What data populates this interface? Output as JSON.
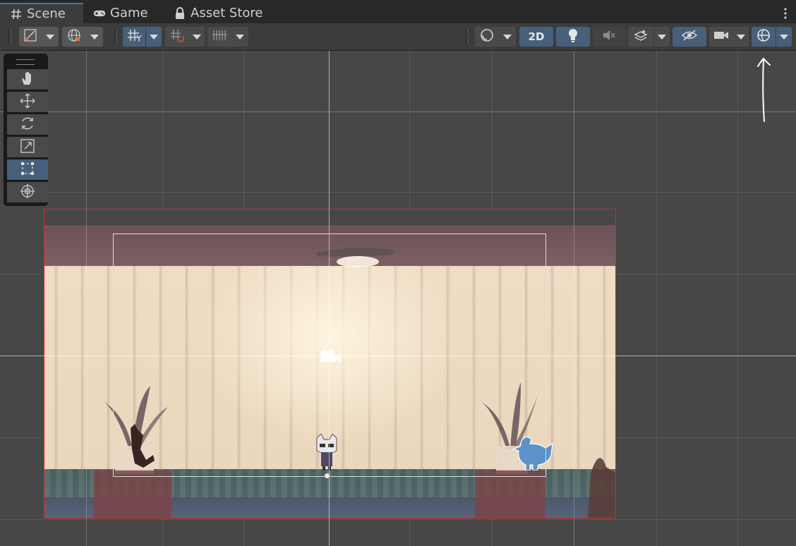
{
  "tabs": [
    {
      "label": "Scene",
      "icon": "hash-icon",
      "active": true
    },
    {
      "label": "Game",
      "icon": "gamepad-icon",
      "active": false
    },
    {
      "label": "Asset Store",
      "icon": "lock-icon",
      "active": false
    }
  ],
  "toolbar": {
    "mode_2d_label": "2D"
  },
  "tools": [
    {
      "name": "hand-tool",
      "icon": "hand-icon",
      "selected": false
    },
    {
      "name": "move-tool",
      "icon": "move-icon",
      "selected": false
    },
    {
      "name": "rotate-tool",
      "icon": "rotate-icon",
      "selected": false
    },
    {
      "name": "scale-tool",
      "icon": "scale-icon",
      "selected": false
    },
    {
      "name": "rect-tool",
      "icon": "rect-icon",
      "selected": true
    },
    {
      "name": "transform-tool",
      "icon": "transform-icon",
      "selected": false
    }
  ],
  "colors": {
    "accent": "#46607c",
    "stage_border": "#d92a2a"
  }
}
